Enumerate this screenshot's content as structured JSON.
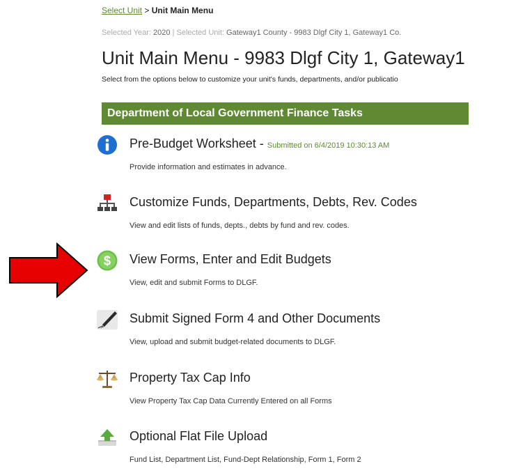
{
  "breadcrumb": {
    "link": "Select Unit",
    "separator": ">",
    "current": "Unit Main Menu"
  },
  "selected": {
    "year_label": "Selected Year:",
    "year": "2020",
    "divider": "|",
    "unit_label": "Selected Unit:",
    "unit": "Gateway1 County - 9983 Dlgf City 1, Gateway1 Co."
  },
  "page_title": "Unit Main Menu - 9983 Dlgf City 1, Gateway1",
  "subtitle": "Select from the options below to customize your unit's funds, departments, and/or publicatio",
  "section_header": "Department of Local Government Finance Tasks",
  "tasks": [
    {
      "icon": "info-icon",
      "title": "Pre-Budget Worksheet -",
      "status": "Submitted on 6/4/2019 10:30:13 AM",
      "desc": "Provide information and estimates in advance."
    },
    {
      "icon": "org-chart-icon",
      "title": "Customize Funds, Departments, Debts, Rev. Codes",
      "desc": "View and edit lists of funds, depts., debts by fund and rev. codes."
    },
    {
      "icon": "dollar-icon",
      "title": "View Forms, Enter and Edit Budgets",
      "desc": "View, edit and submit Forms to DLGF."
    },
    {
      "icon": "pen-icon",
      "title": "Submit Signed Form 4 and Other Documents",
      "desc": "View, upload and submit budget-related documents to DLGF."
    },
    {
      "icon": "scales-icon",
      "title": "Property Tax Cap Info",
      "desc": "View Property Tax Cap Data Currently Entered on all Forms"
    },
    {
      "icon": "upload-icon",
      "title": "Optional Flat File Upload",
      "desc": "Fund List, Department List, Fund-Dept Relationship, Form 1, Form 2"
    }
  ],
  "colors": {
    "accent_green": "#5f8a33",
    "link_green": "#5e8b2c",
    "arrow_red": "#e60000",
    "info_blue": "#1e6fd1",
    "dollar_green": "#6cbf4a"
  }
}
